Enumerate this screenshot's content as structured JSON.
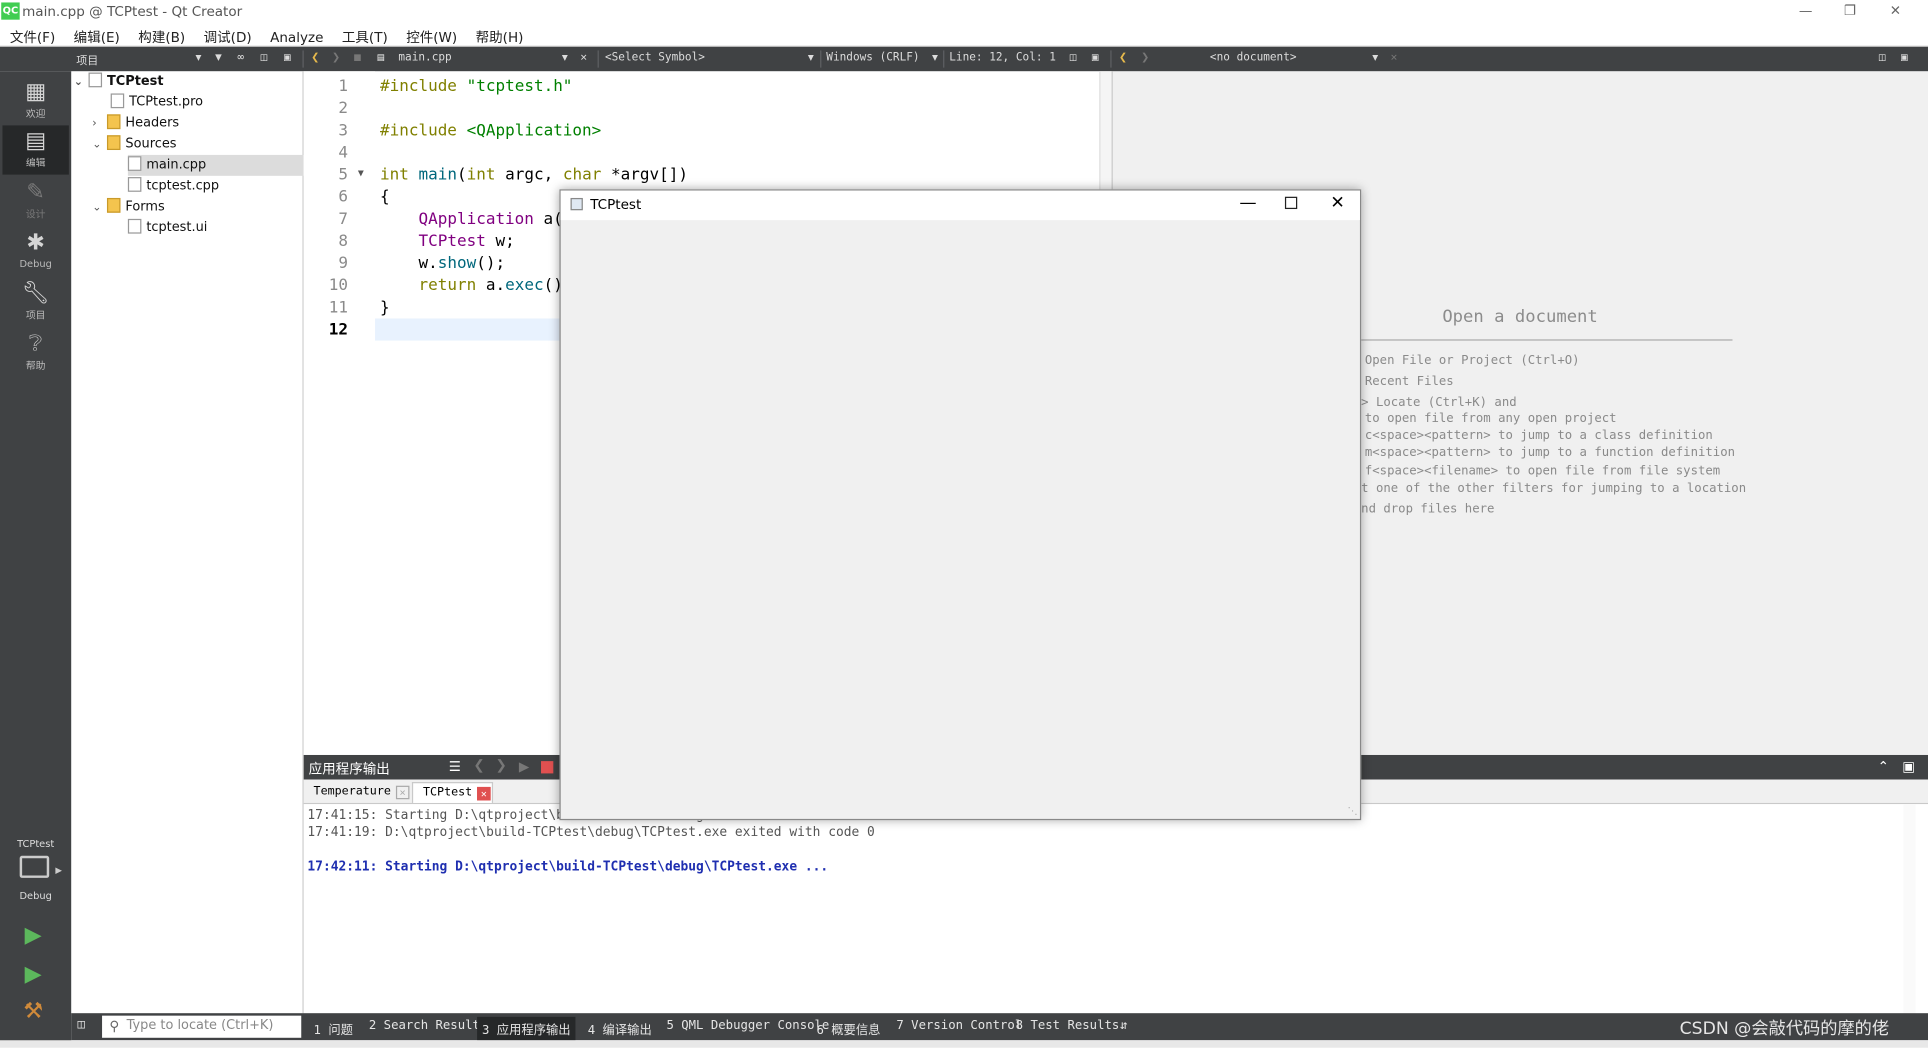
{
  "window": {
    "title": "main.cpp @ TCPtest - Qt Creator",
    "logo": "QC",
    "min_icon": "minimize-icon",
    "max_icon": "restore-icon",
    "close_icon": "close-icon"
  },
  "menu": [
    "文件(F)",
    "编辑(E)",
    "构建(B)",
    "调试(D)",
    "Analyze",
    "工具(T)",
    "控件(W)",
    "帮助(H)"
  ],
  "toolbar": {
    "project_combo": "项目",
    "file_combo": "main.cpp",
    "symbol_combo": "<Select Symbol>",
    "line_ending": "Windows (CRLF)",
    "position": "Line: 12, Col: 1",
    "right_doc": "<no document>"
  },
  "modes": [
    {
      "label": "欢迎",
      "icon": "grid-icon"
    },
    {
      "label": "编辑",
      "icon": "edit-icon"
    },
    {
      "label": "设计",
      "icon": "pencil-icon"
    },
    {
      "label": "Debug",
      "icon": "bug-icon"
    },
    {
      "label": "项目",
      "icon": "wrench-icon"
    },
    {
      "label": "帮助",
      "icon": "help-icon"
    }
  ],
  "kit": {
    "project": "TCPtest",
    "config": "Debug"
  },
  "tree": {
    "root": "TCPtest",
    "items": [
      "TCPtest.pro",
      "Headers",
      "Sources",
      "main.cpp",
      "tcptest.cpp",
      "Forms",
      "tcptest.ui"
    ]
  },
  "editor": {
    "line_numbers": [
      "1",
      "2",
      "3",
      "4",
      "5",
      "6",
      "7",
      "8",
      "9",
      "10",
      "11",
      "12"
    ],
    "current_line": "12"
  },
  "right_pane": {
    "heading": "Open a document",
    "lines": [
      "Open File or Project (Ctrl+O)",
      "Recent Files",
      "> Locate (Ctrl+K) and",
      "to open file from any open project",
      "c<space><pattern> to jump to a class definition",
      "m<space><pattern> to jump to a function definition",
      "f<space><filename> to open file from file system",
      "t one of the other filters for jumping to a location",
      "nd drop files here"
    ]
  },
  "output": {
    "title": "应用程序输出",
    "tabs": [
      "Temperature",
      "TCPtest"
    ],
    "lines": [
      "17:41:15: Starting D:\\qtproject\\build-TCPtest\\debug\\TCPtest.exe ...",
      "17:41:19: D:\\qtproject\\build-TCPtest\\debug\\TCPtest.exe exited with code 0",
      "17:42:11: Starting D:\\qtproject\\build-TCPtest\\debug\\TCPtest.exe ..."
    ]
  },
  "popup": {
    "title": "TCPtest"
  },
  "statusbar": {
    "locate_placeholder": "Type to locate (Ctrl+K)",
    "items": [
      "1 问题",
      "2 Search Results",
      "3 应用程序输出",
      "4 编译输出",
      "5 QML Debugger Console",
      "6 概要信息",
      "7 Version Control",
      "8 Test Results"
    ]
  },
  "watermark": "CSDN @会敲代码的摩的佬"
}
